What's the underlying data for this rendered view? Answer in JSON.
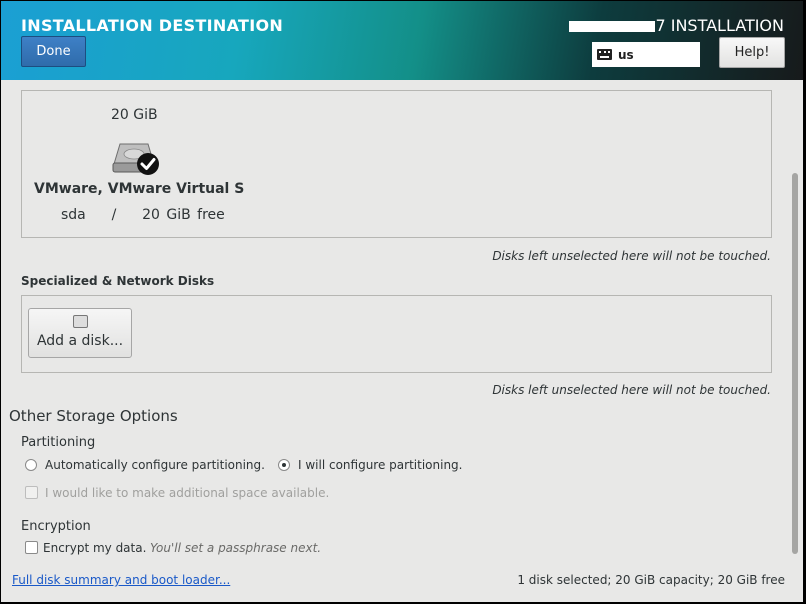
{
  "header": {
    "title": "INSTALLATION DESTINATION",
    "done_label": "Done",
    "product_suffix": "7 INSTALLATION",
    "keyboard_layout": "us",
    "help_label": "Help!"
  },
  "local_disk": {
    "size": "20 GiB",
    "name": "VMware, VMware Virtual S",
    "device": "sda",
    "separator": "/",
    "free": "20 GiB free",
    "icon": "harddisk-selected-icon"
  },
  "notes": {
    "unselected_local": "Disks left unselected here will not be touched.",
    "unselected_network": "Disks left unselected here will not be touched."
  },
  "specialized": {
    "label": "Specialized & Network Disks",
    "add_disk_label": "Add a disk...",
    "add_disk_icon": "disk-icon"
  },
  "other_storage": {
    "title": "Other Storage Options",
    "partitioning_label": "Partitioning",
    "auto_label": "Automatically configure partitioning.",
    "manual_label": "I will configure partitioning.",
    "selected": "manual",
    "extra_space_label": "I would like to make additional space available.",
    "encryption_label": "Encryption",
    "encrypt_label": "Encrypt my data.",
    "encrypt_hint": "You'll set a passphrase next."
  },
  "footer": {
    "summary_link": "Full disk summary and boot loader...",
    "status": "1 disk selected; 20 GiB capacity; 20 GiB free"
  },
  "colors": {
    "accent": "#2f6cab",
    "link": "#1a59c8"
  }
}
